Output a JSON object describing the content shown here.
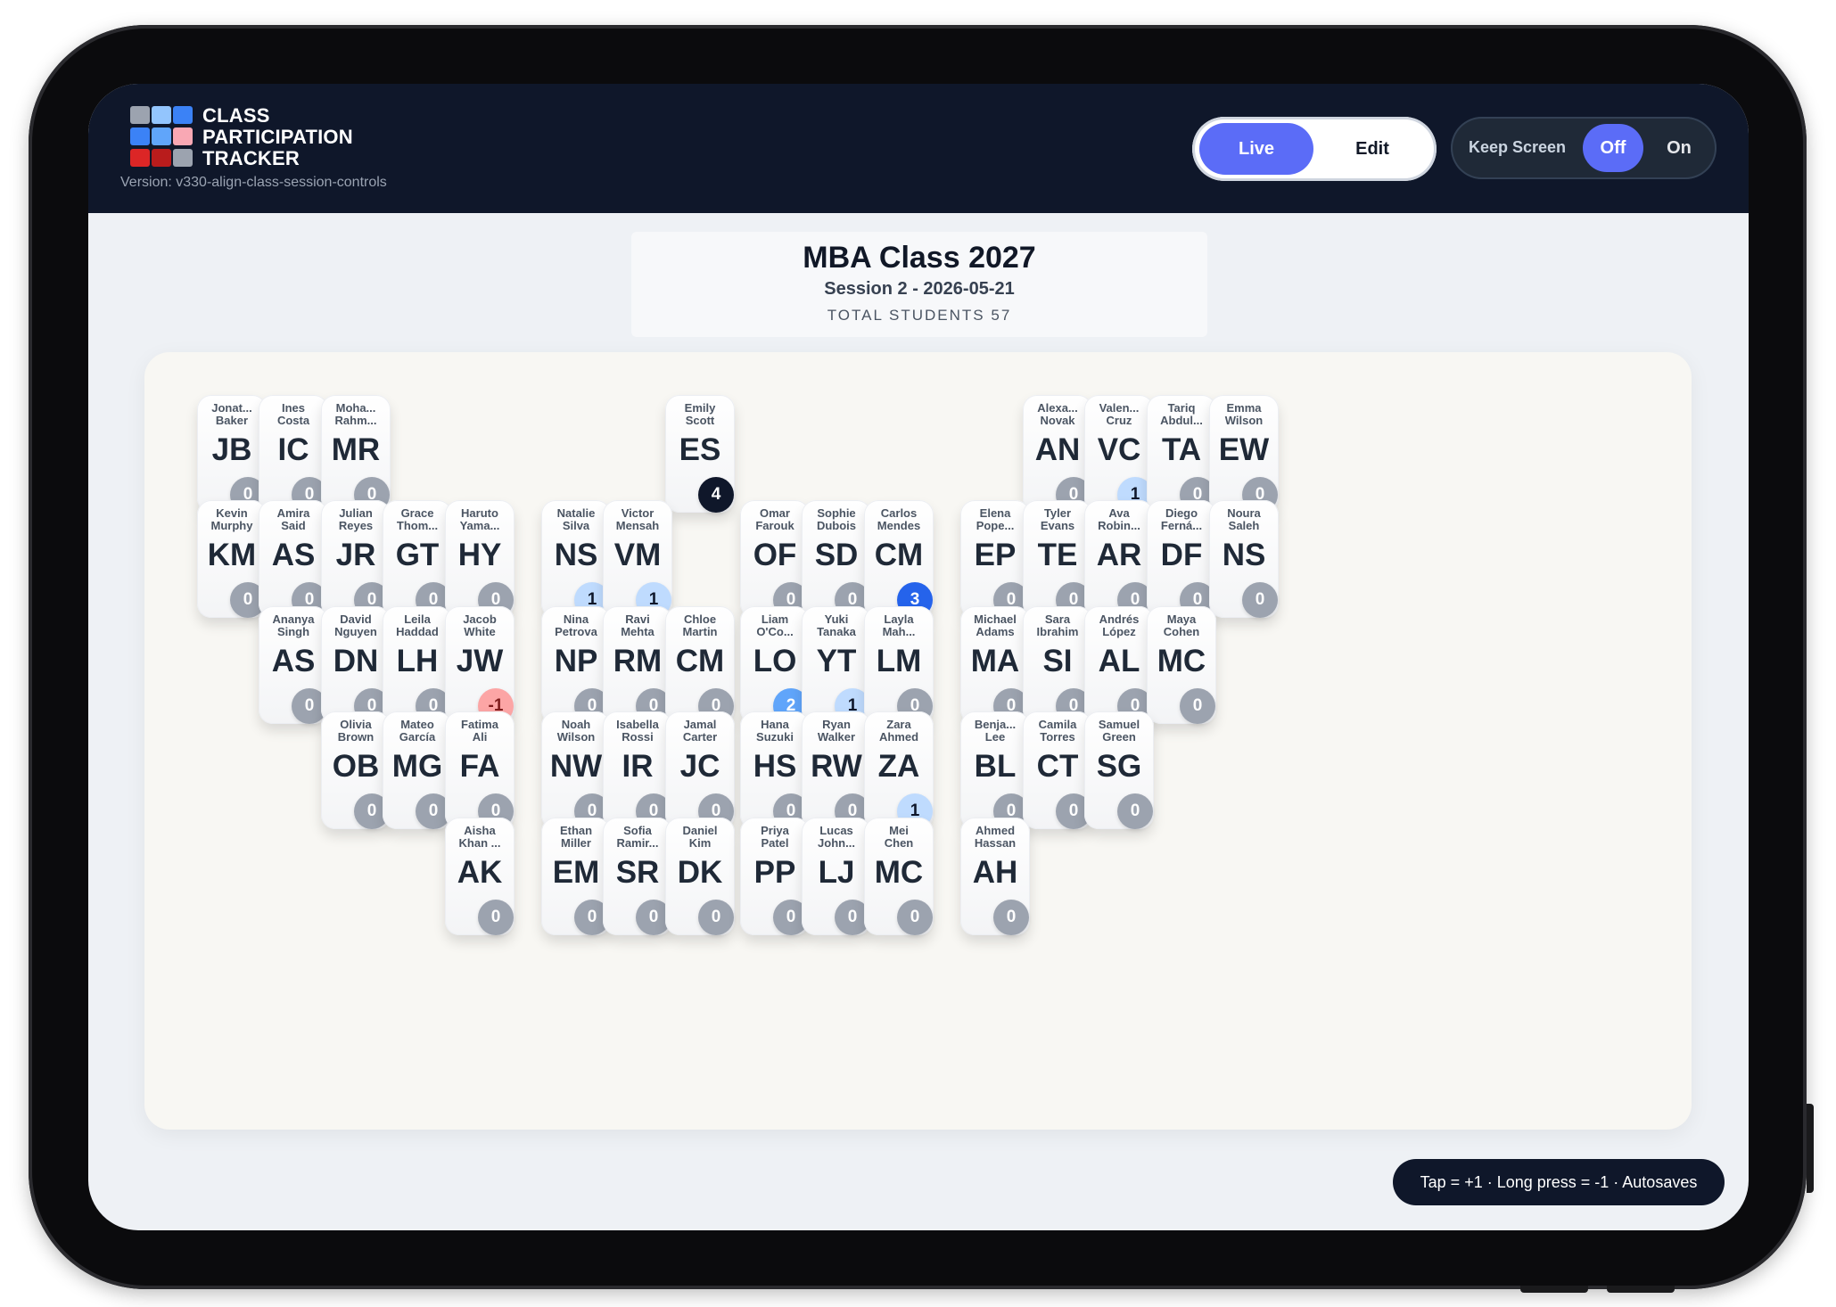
{
  "app": {
    "brand_lines": [
      "CLASS",
      "PARTICIPATION",
      "TRACKER"
    ],
    "version": "Version: v330-align-class-session-controls",
    "mode_live": "Live",
    "mode_edit": "Edit",
    "keep_screen_label": "Keep Screen",
    "keep_off": "Off",
    "keep_on": "On",
    "logo_colors": [
      "#9ca3af",
      "#93c5fd",
      "#3b82f6",
      "#3b82f6",
      "#60a5fa",
      "#f9a8b4",
      "#dc2626",
      "#b91c1c",
      "#9ca3af"
    ]
  },
  "header": {
    "title": "MBA Class 2027",
    "session": "Session 2 - 2026-05-21",
    "total": "TOTAL STUDENTS 57"
  },
  "hint": "Tap = +1 · Long press = -1 · Autosaves",
  "students": [
    {
      "row": 0,
      "col": 0,
      "name": "Jonat...\nBaker",
      "ini": "JB",
      "count": 0
    },
    {
      "row": 0,
      "col": 1,
      "name": "Ines\nCosta",
      "ini": "IC",
      "count": 0
    },
    {
      "row": 0,
      "col": 2,
      "name": "Moha...\nRahm...",
      "ini": "MR",
      "count": 0
    },
    {
      "row": 0,
      "col": 8,
      "name": "Emily\nScott",
      "ini": "ES",
      "count": 4
    },
    {
      "row": 0,
      "col": 14,
      "name": "Alexa...\nNovak",
      "ini": "AN",
      "count": 0
    },
    {
      "row": 0,
      "col": 15,
      "name": "Valen...\nCruz",
      "ini": "VC",
      "count": 1
    },
    {
      "row": 0,
      "col": 16,
      "name": "Tariq\nAbdul...",
      "ini": "TA",
      "count": 0
    },
    {
      "row": 0,
      "col": 17,
      "name": "Emma\nWilson",
      "ini": "EW",
      "count": 0
    },
    {
      "row": 1,
      "col": 0,
      "name": "Kevin\nMurphy",
      "ini": "KM",
      "count": 0
    },
    {
      "row": 1,
      "col": 1,
      "name": "Amira\nSaid",
      "ini": "AS",
      "count": 0
    },
    {
      "row": 1,
      "col": 2,
      "name": "Julian\nReyes",
      "ini": "JR",
      "count": 0
    },
    {
      "row": 1,
      "col": 3,
      "name": "Grace\nThom...",
      "ini": "GT",
      "count": 0
    },
    {
      "row": 1,
      "col": 4,
      "name": "Haruto\nYama...",
      "ini": "HY",
      "count": 0
    },
    {
      "row": 1,
      "col": 6,
      "name": "Natalie\nSilva",
      "ini": "NS",
      "count": 1
    },
    {
      "row": 1,
      "col": 7,
      "name": "Victor\nMensah",
      "ini": "VM",
      "count": 1
    },
    {
      "row": 1,
      "col": 9,
      "name": "Omar\nFarouk",
      "ini": "OF",
      "count": 0
    },
    {
      "row": 1,
      "col": 10,
      "name": "Sophie\nDubois",
      "ini": "SD",
      "count": 0
    },
    {
      "row": 1,
      "col": 11,
      "name": "Carlos\nMendes",
      "ini": "CM",
      "count": 3
    },
    {
      "row": 1,
      "col": 13,
      "name": "Elena\nPope...",
      "ini": "EP",
      "count": 0
    },
    {
      "row": 1,
      "col": 14,
      "name": "Tyler\nEvans",
      "ini": "TE",
      "count": 0
    },
    {
      "row": 1,
      "col": 15,
      "name": "Ava\nRobin...",
      "ini": "AR",
      "count": 0
    },
    {
      "row": 1,
      "col": 16,
      "name": "Diego\nFerná...",
      "ini": "DF",
      "count": 0
    },
    {
      "row": 1,
      "col": 17,
      "name": "Noura\nSaleh",
      "ini": "NS",
      "count": 0
    },
    {
      "row": 2,
      "col": 1,
      "name": "Ananya\nSingh",
      "ini": "AS",
      "count": 0
    },
    {
      "row": 2,
      "col": 2,
      "name": "David\nNguyen",
      "ini": "DN",
      "count": 0
    },
    {
      "row": 2,
      "col": 3,
      "name": "Leila\nHaddad",
      "ini": "LH",
      "count": 0
    },
    {
      "row": 2,
      "col": 4,
      "name": "Jacob\nWhite",
      "ini": "JW",
      "count": -1
    },
    {
      "row": 2,
      "col": 6,
      "name": "Nina\nPetrova",
      "ini": "NP",
      "count": 0
    },
    {
      "row": 2,
      "col": 7,
      "name": "Ravi\nMehta",
      "ini": "RM",
      "count": 0
    },
    {
      "row": 2,
      "col": 8,
      "name": "Chloe\nMartin",
      "ini": "CM",
      "count": 0
    },
    {
      "row": 2,
      "col": 9,
      "name": "Liam\nO'Co...",
      "ini": "LO",
      "count": 2
    },
    {
      "row": 2,
      "col": 10,
      "name": "Yuki\nTanaka",
      "ini": "YT",
      "count": 1
    },
    {
      "row": 2,
      "col": 11,
      "name": "Layla\nMah...",
      "ini": "LM",
      "count": 0
    },
    {
      "row": 2,
      "col": 13,
      "name": "Michael\nAdams",
      "ini": "MA",
      "count": 0
    },
    {
      "row": 2,
      "col": 14,
      "name": "Sara\nIbrahim",
      "ini": "SI",
      "count": 0
    },
    {
      "row": 2,
      "col": 15,
      "name": "Andrés\nLópez",
      "ini": "AL",
      "count": 0
    },
    {
      "row": 2,
      "col": 16,
      "name": "Maya\nCohen",
      "ini": "MC",
      "count": 0
    },
    {
      "row": 3,
      "col": 2,
      "name": "Olivia\nBrown",
      "ini": "OB",
      "count": 0
    },
    {
      "row": 3,
      "col": 3,
      "name": "Mateo\nGarcía",
      "ini": "MG",
      "count": 0
    },
    {
      "row": 3,
      "col": 4,
      "name": "Fatima\nAli",
      "ini": "FA",
      "count": 0
    },
    {
      "row": 3,
      "col": 6,
      "name": "Noah\nWilson",
      "ini": "NW",
      "count": 0
    },
    {
      "row": 3,
      "col": 7,
      "name": "Isabella\nRossi",
      "ini": "IR",
      "count": 0
    },
    {
      "row": 3,
      "col": 8,
      "name": "Jamal\nCarter",
      "ini": "JC",
      "count": 0
    },
    {
      "row": 3,
      "col": 9,
      "name": "Hana\nSuzuki",
      "ini": "HS",
      "count": 0
    },
    {
      "row": 3,
      "col": 10,
      "name": "Ryan\nWalker",
      "ini": "RW",
      "count": 0
    },
    {
      "row": 3,
      "col": 11,
      "name": "Zara\nAhmed",
      "ini": "ZA",
      "count": 1
    },
    {
      "row": 3,
      "col": 13,
      "name": "Benja...\nLee",
      "ini": "BL",
      "count": 0
    },
    {
      "row": 3,
      "col": 14,
      "name": "Camila\nTorres",
      "ini": "CT",
      "count": 0
    },
    {
      "row": 3,
      "col": 15,
      "name": "Samuel\nGreen",
      "ini": "SG",
      "count": 0
    },
    {
      "row": 4,
      "col": 4,
      "name": "Aisha\nKhan ...",
      "ini": "AK",
      "count": 0
    },
    {
      "row": 4,
      "col": 6,
      "name": "Ethan\nMiller",
      "ini": "EM",
      "count": 0
    },
    {
      "row": 4,
      "col": 7,
      "name": "Sofia\nRamir...",
      "ini": "SR",
      "count": 0
    },
    {
      "row": 4,
      "col": 8,
      "name": "Daniel\nKim",
      "ini": "DK",
      "count": 0
    },
    {
      "row": 4,
      "col": 9,
      "name": "Priya\nPatel",
      "ini": "PP",
      "count": 0
    },
    {
      "row": 4,
      "col": 10,
      "name": "Lucas\nJohn...",
      "ini": "LJ",
      "count": 0
    },
    {
      "row": 4,
      "col": 11,
      "name": "Mei\nChen",
      "ini": "MC",
      "count": 0
    },
    {
      "row": 4,
      "col": 13,
      "name": "Ahmed\nHassan",
      "ini": "AH",
      "count": 0
    }
  ]
}
